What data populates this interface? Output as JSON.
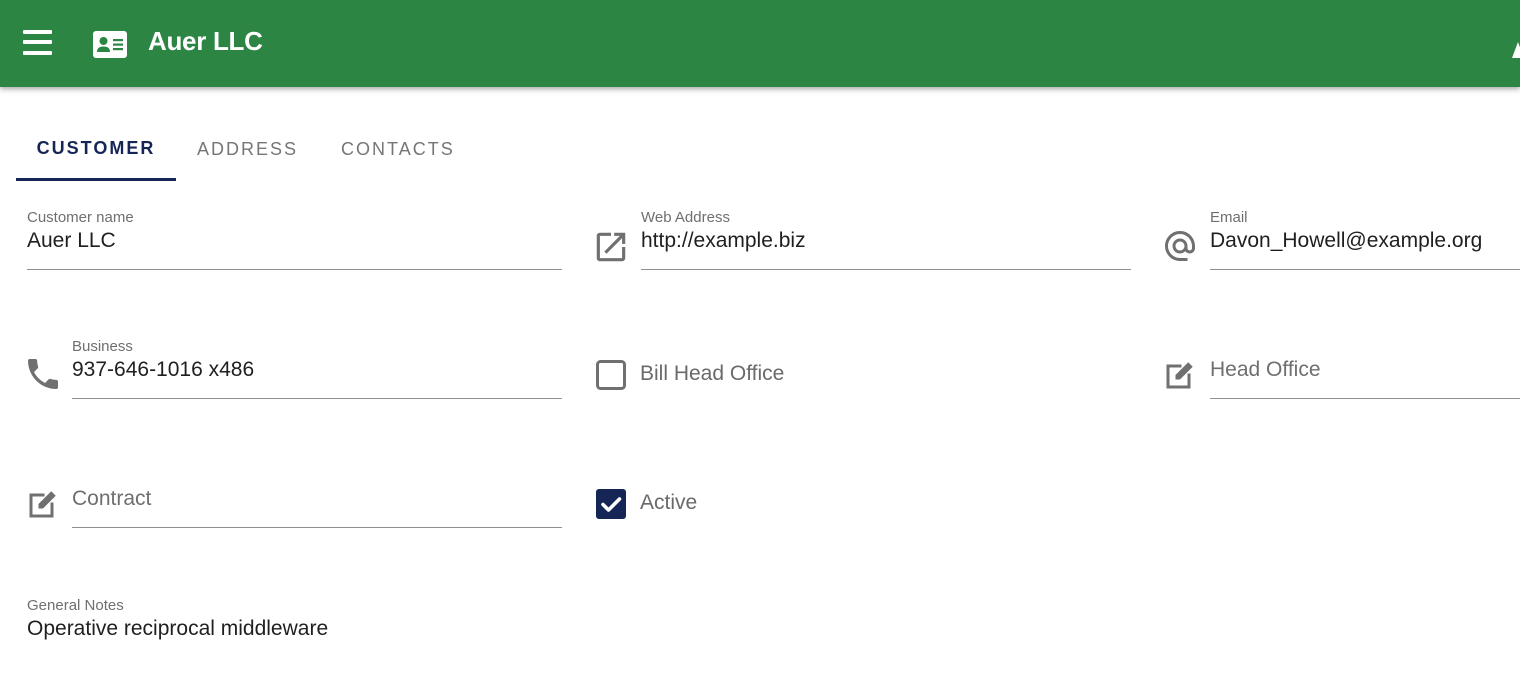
{
  "appbar": {
    "title": "Auer LLC",
    "menu_icon": "hamburger-menu-icon",
    "title_icon": "contact-card-icon",
    "right_icon": "account-icon",
    "background_color": "#2c8542"
  },
  "tabs": [
    {
      "label": "CUSTOMER",
      "active": true
    },
    {
      "label": "ADDRESS",
      "active": false
    },
    {
      "label": "CONTACTS",
      "active": false
    }
  ],
  "form": {
    "customer_name": {
      "label": "Customer name",
      "value": "Auer LLC"
    },
    "web_address": {
      "label": "Web Address",
      "value": "http://example.biz",
      "icon": "open-in-new-icon"
    },
    "email": {
      "label": "Email",
      "value": "Davon_Howell@example.org",
      "icon": "at-sign-icon"
    },
    "business_phone": {
      "label": "Business",
      "value": "937-646-1016 x486",
      "icon": "phone-icon"
    },
    "bill_head_office": {
      "label": "Bill Head Office",
      "checked": false
    },
    "head_office": {
      "placeholder": "Head Office",
      "value": "",
      "icon": "edit-icon"
    },
    "contract": {
      "placeholder": "Contract",
      "value": "",
      "icon": "edit-icon"
    },
    "active": {
      "label": "Active",
      "checked": true
    },
    "general_notes": {
      "label": "General Notes",
      "value": "Operative reciprocal middleware"
    }
  },
  "colors": {
    "accent": "#152556",
    "appbar": "#2c8542",
    "icon_gray": "#707070"
  }
}
